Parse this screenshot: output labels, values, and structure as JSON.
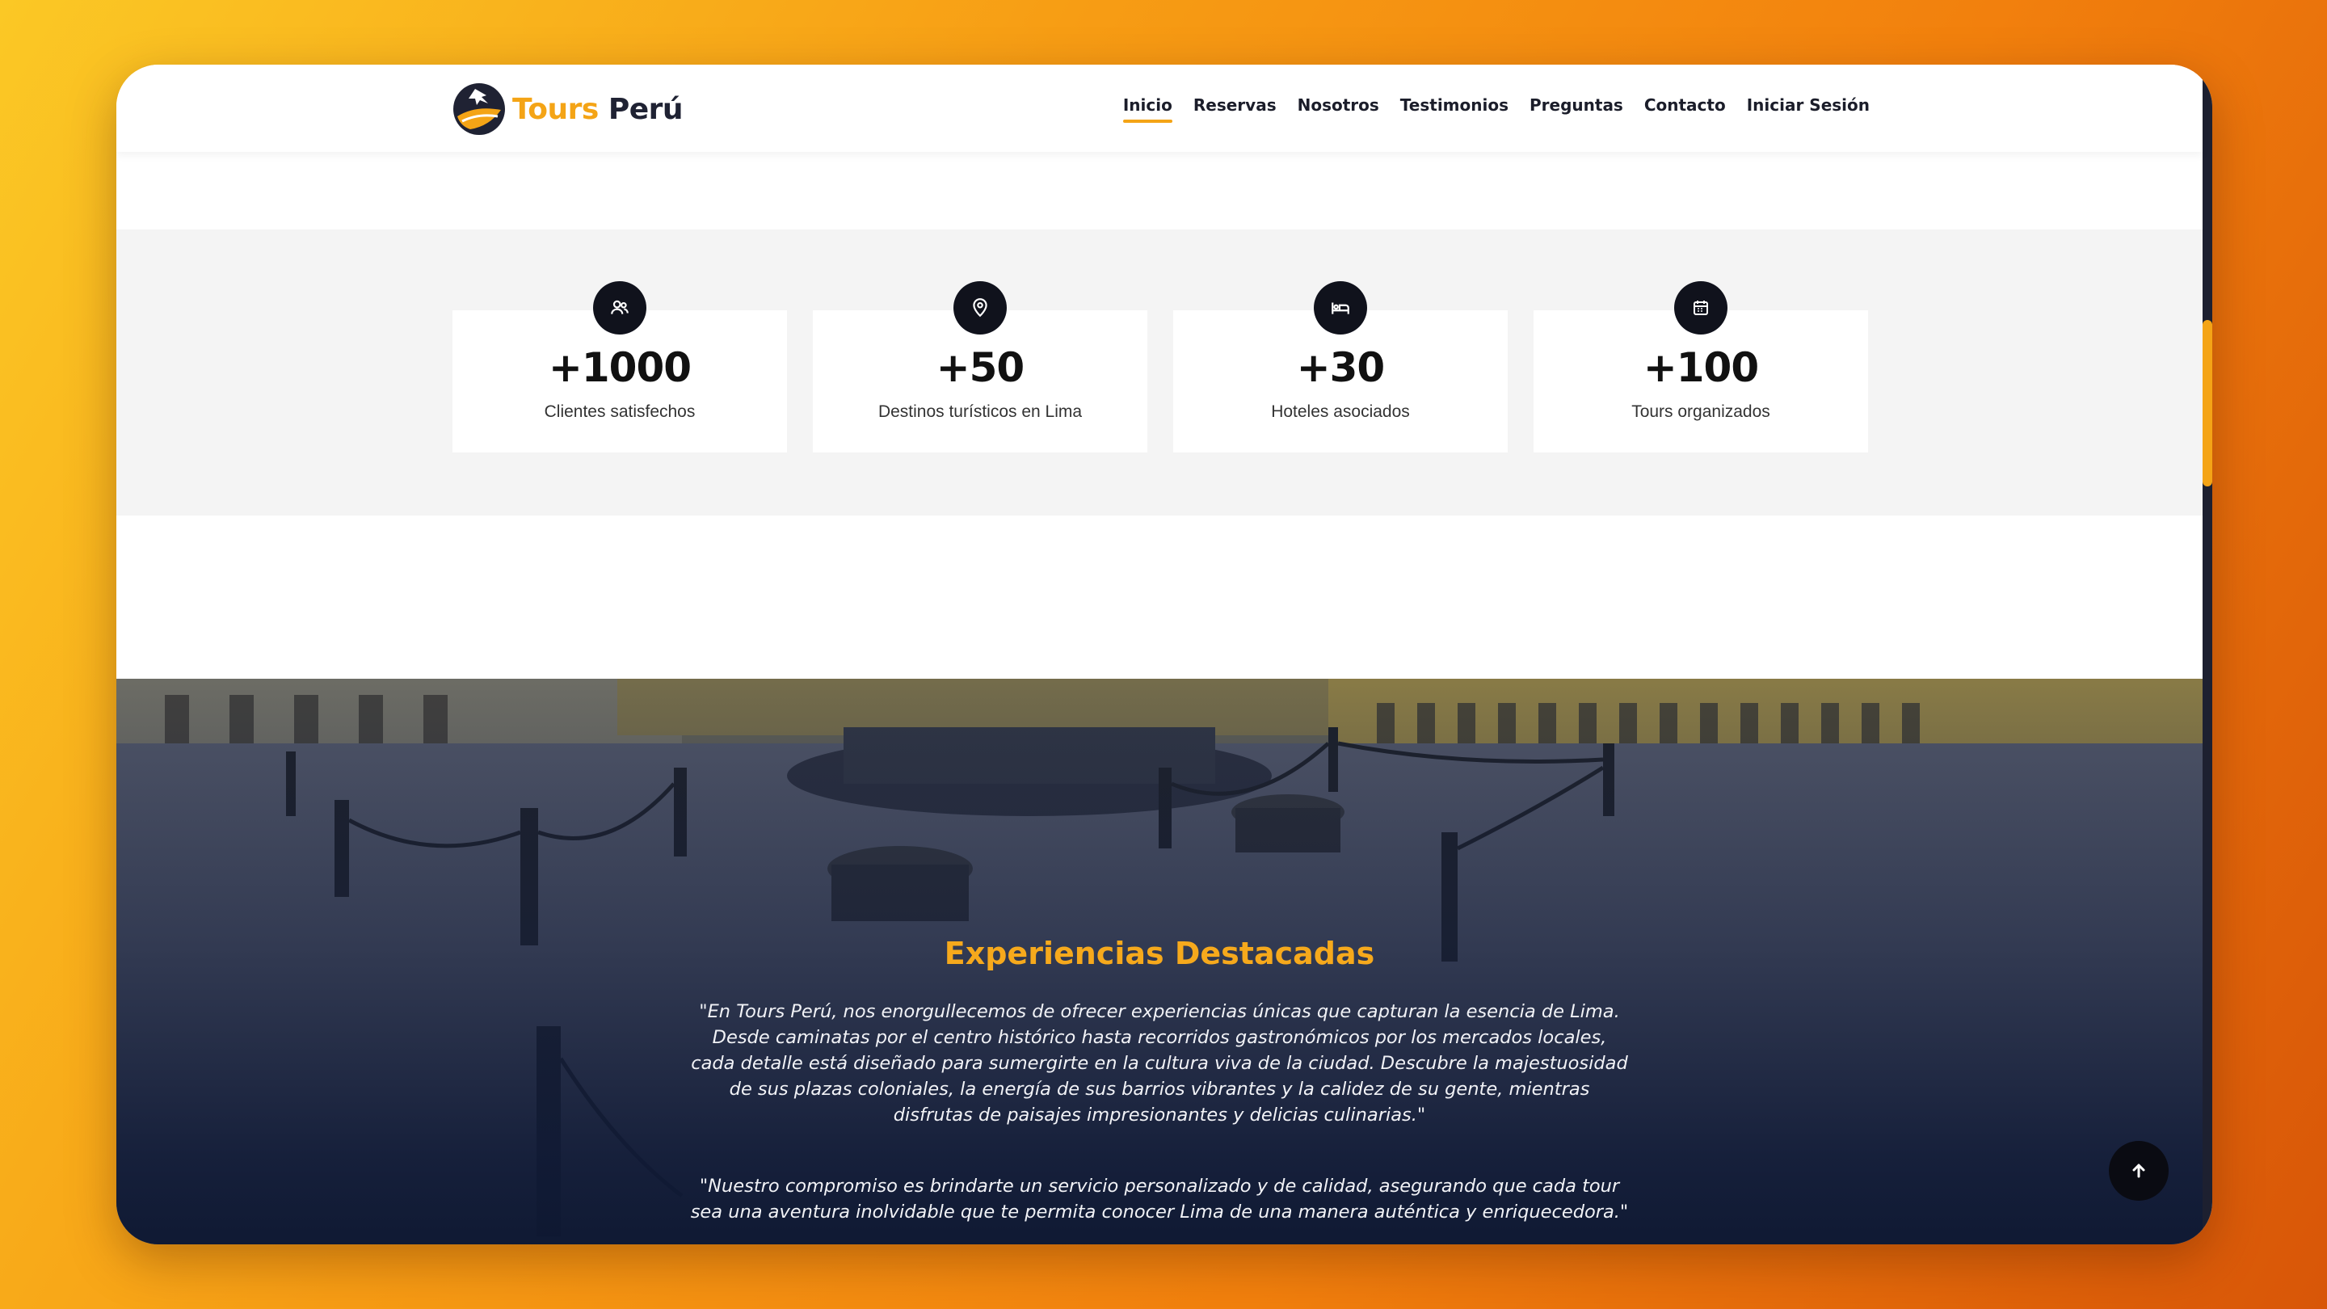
{
  "brand": {
    "word1": "Tours",
    "word2": "Perú"
  },
  "nav": {
    "items": [
      {
        "label": "Inicio"
      },
      {
        "label": "Reservas"
      },
      {
        "label": "Nosotros"
      },
      {
        "label": "Testimonios"
      },
      {
        "label": "Preguntas"
      },
      {
        "label": "Contacto"
      },
      {
        "label": "Iniciar Sesión"
      }
    ],
    "active": "Inicio"
  },
  "stats": [
    {
      "icon": "users-icon",
      "value": "+1000",
      "label": "Clientes satisfechos"
    },
    {
      "icon": "map-pin-icon",
      "value": "+50",
      "label": "Destinos turísticos en Lima"
    },
    {
      "icon": "bed-icon",
      "value": "+30",
      "label": "Hoteles asociados"
    },
    {
      "icon": "calendar-icon",
      "value": "+100",
      "label": "Tours organizados"
    }
  ],
  "experiences": {
    "title": "Experiencias Destacadas",
    "paragraph1": "\"En Tours Perú, nos enorgullecemos de ofrecer experiencias únicas que capturan la esencia de Lima. Desde caminatas por el centro histórico hasta recorridos gastronómicos por los mercados locales, cada detalle está diseñado para sumergirte en la cultura viva de la ciudad. Descubre la majestuosidad de sus plazas coloniales, la energía de sus barrios vibrantes y la calidez de su gente, mientras disfrutas de paisajes impresionantes y delicias culinarias.\"",
    "paragraph2": "\"Nuestro compromiso es brindarte un servicio personalizado y de calidad, asegurando que cada tour sea una aventura inolvidable que te permita conocer Lima de una manera auténtica y enriquecedora.\""
  },
  "colors": {
    "accent": "#f4a416",
    "dark": "#10121c",
    "hero_overlay": "#1d2740"
  },
  "scroll_top_icon": "arrow-up-icon"
}
